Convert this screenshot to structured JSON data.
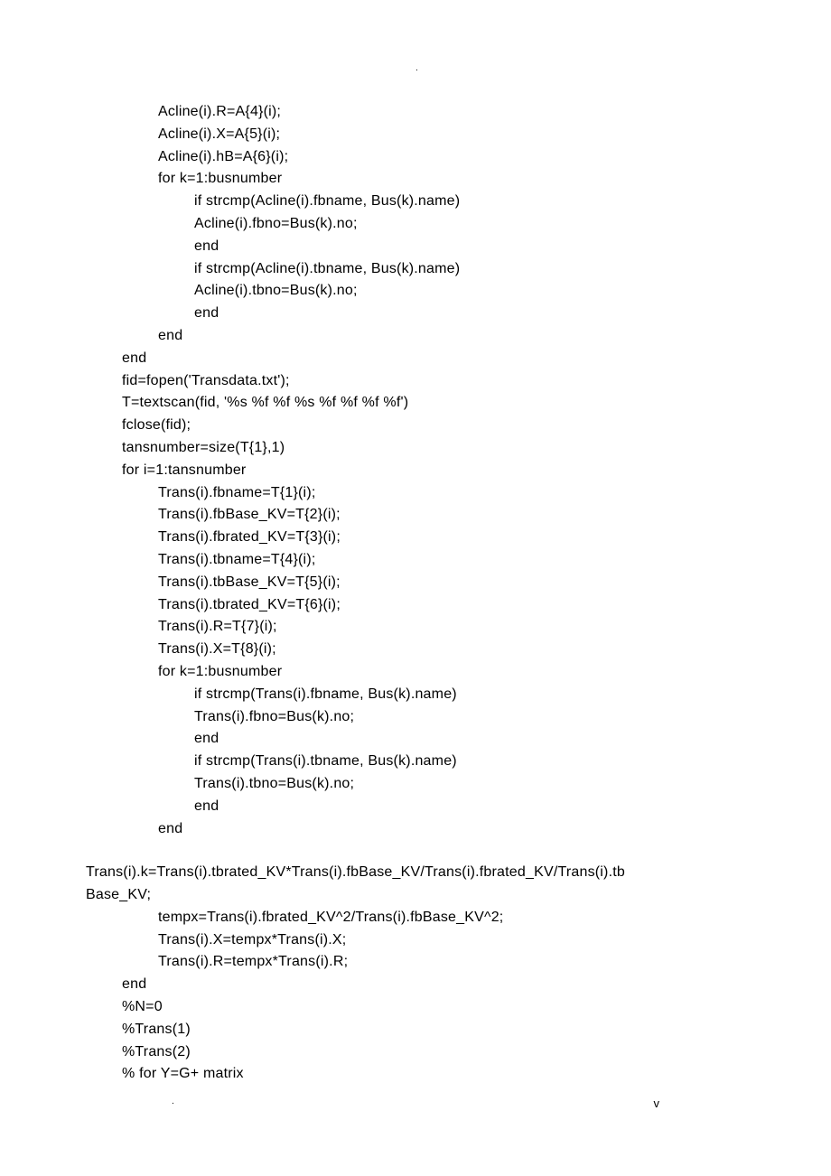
{
  "code": {
    "lines": [
      {
        "indent": "indent-2",
        "text": "Acline(i).R=A{4}(i);"
      },
      {
        "indent": "indent-2",
        "text": "Acline(i).X=A{5}(i);"
      },
      {
        "indent": "indent-2",
        "text": "Acline(i).hB=A{6}(i);"
      },
      {
        "indent": "indent-2",
        "text": "for k=1:busnumber"
      },
      {
        "indent": "indent-3",
        "text": "if strcmp(Acline(i).fbname, Bus(k).name)"
      },
      {
        "indent": "indent-3",
        "text": "Acline(i).fbno=Bus(k).no;"
      },
      {
        "indent": "indent-3",
        "text": "end"
      },
      {
        "indent": "indent-3",
        "text": "if strcmp(Acline(i).tbname, Bus(k).name)"
      },
      {
        "indent": "indent-3",
        "text": "Acline(i).tbno=Bus(k).no;"
      },
      {
        "indent": "indent-3",
        "text": "end"
      },
      {
        "indent": "indent-2",
        "text": "end"
      },
      {
        "indent": "indent-1",
        "text": "end"
      },
      {
        "indent": "indent-1",
        "text": "fid=fopen('Transdata.txt');"
      },
      {
        "indent": "indent-1",
        "text": "T=textscan(fid, '%s %f %f %s %f %f %f %f')"
      },
      {
        "indent": "indent-1",
        "text": "fclose(fid);"
      },
      {
        "indent": "indent-1",
        "text": "tansnumber=size(T{1},1)"
      },
      {
        "indent": "indent-1",
        "text": "for i=1:tansnumber"
      },
      {
        "indent": "indent-2",
        "text": "Trans(i).fbname=T{1}(i);"
      },
      {
        "indent": "indent-2",
        "text": "Trans(i).fbBase_KV=T{2}(i);"
      },
      {
        "indent": "indent-2",
        "text": "Trans(i).fbrated_KV=T{3}(i);"
      },
      {
        "indent": "indent-2",
        "text": "Trans(i).tbname=T{4}(i);"
      },
      {
        "indent": "indent-2",
        "text": "Trans(i).tbBase_KV=T{5}(i);"
      },
      {
        "indent": "indent-2",
        "text": "Trans(i).tbrated_KV=T{6}(i);"
      },
      {
        "indent": "indent-2",
        "text": "Trans(i).R=T{7}(i);"
      },
      {
        "indent": "indent-2",
        "text": "Trans(i).X=T{8}(i);"
      },
      {
        "indent": "indent-2",
        "text": "for k=1:busnumber"
      },
      {
        "indent": "indent-3",
        "text": "if strcmp(Trans(i).fbname, Bus(k).name)"
      },
      {
        "indent": "indent-3",
        "text": "Trans(i).fbno=Bus(k).no;"
      },
      {
        "indent": "indent-3",
        "text": "end"
      },
      {
        "indent": "indent-3",
        "text": "if strcmp(Trans(i).tbname, Bus(k).name)"
      },
      {
        "indent": "indent-3",
        "text": "Trans(i).tbno=Bus(k).no;"
      },
      {
        "indent": "indent-3",
        "text": "end"
      },
      {
        "indent": "indent-2",
        "text": "end"
      }
    ],
    "break_lines": [
      {
        "indent": "no-indent",
        "text": "Trans(i).k=Trans(i).tbrated_KV*Trans(i).fbBase_KV/Trans(i).fbrated_KV/Trans(i).tb"
      },
      {
        "indent": "no-indent",
        "text": "Base_KV;"
      },
      {
        "indent": "indent-2",
        "text": "tempx=Trans(i).fbrated_KV^2/Trans(i).fbBase_KV^2;"
      },
      {
        "indent": "indent-2",
        "text": "Trans(i).X=tempx*Trans(i).X;"
      },
      {
        "indent": "indent-2",
        "text": "Trans(i).R=tempx*Trans(i).R;"
      },
      {
        "indent": "indent-1",
        "text": "end"
      },
      {
        "indent": "indent-1",
        "text": "%N=0"
      },
      {
        "indent": "indent-1",
        "text": "%Trans(1)"
      },
      {
        "indent": "indent-1",
        "text": "%Trans(2)"
      },
      {
        "indent": "indent-1",
        "text": "% for Y=G+ matrix"
      }
    ]
  },
  "footer": {
    "marker": "v"
  }
}
